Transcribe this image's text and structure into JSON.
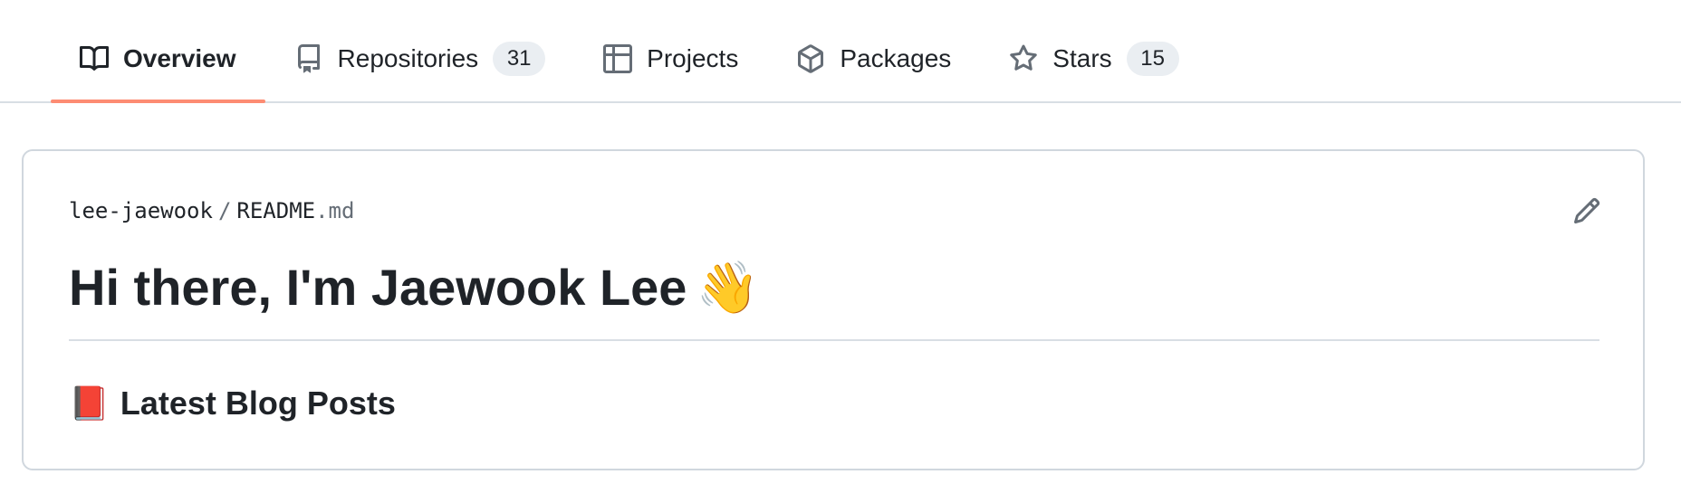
{
  "tabs": [
    {
      "id": "overview",
      "label": "Overview",
      "icon": "book-icon",
      "selected": true
    },
    {
      "id": "repositories",
      "label": "Repositories",
      "icon": "repo-icon",
      "count": "31",
      "selected": false
    },
    {
      "id": "projects",
      "label": "Projects",
      "icon": "table-icon",
      "selected": false
    },
    {
      "id": "packages",
      "label": "Packages",
      "icon": "package-icon",
      "selected": false
    },
    {
      "id": "stars",
      "label": "Stars",
      "icon": "star-icon",
      "count": "15",
      "selected": false
    }
  ],
  "readme": {
    "owner": "lee-jaewook",
    "separator": "/",
    "filename": "README",
    "extension": ".md",
    "edit_icon": "pencil-icon",
    "heading": "Hi there, I'm Jaewook Lee",
    "heading_emoji": "👋",
    "subheading": "Latest Blog Posts",
    "subheading_emoji": "📕"
  },
  "colors": {
    "selected_tab_underline": "#fd8c73",
    "counter_background": "#eaeef2",
    "border": "#d0d7de",
    "text": "#1f2328",
    "muted_text": "#656d76"
  }
}
